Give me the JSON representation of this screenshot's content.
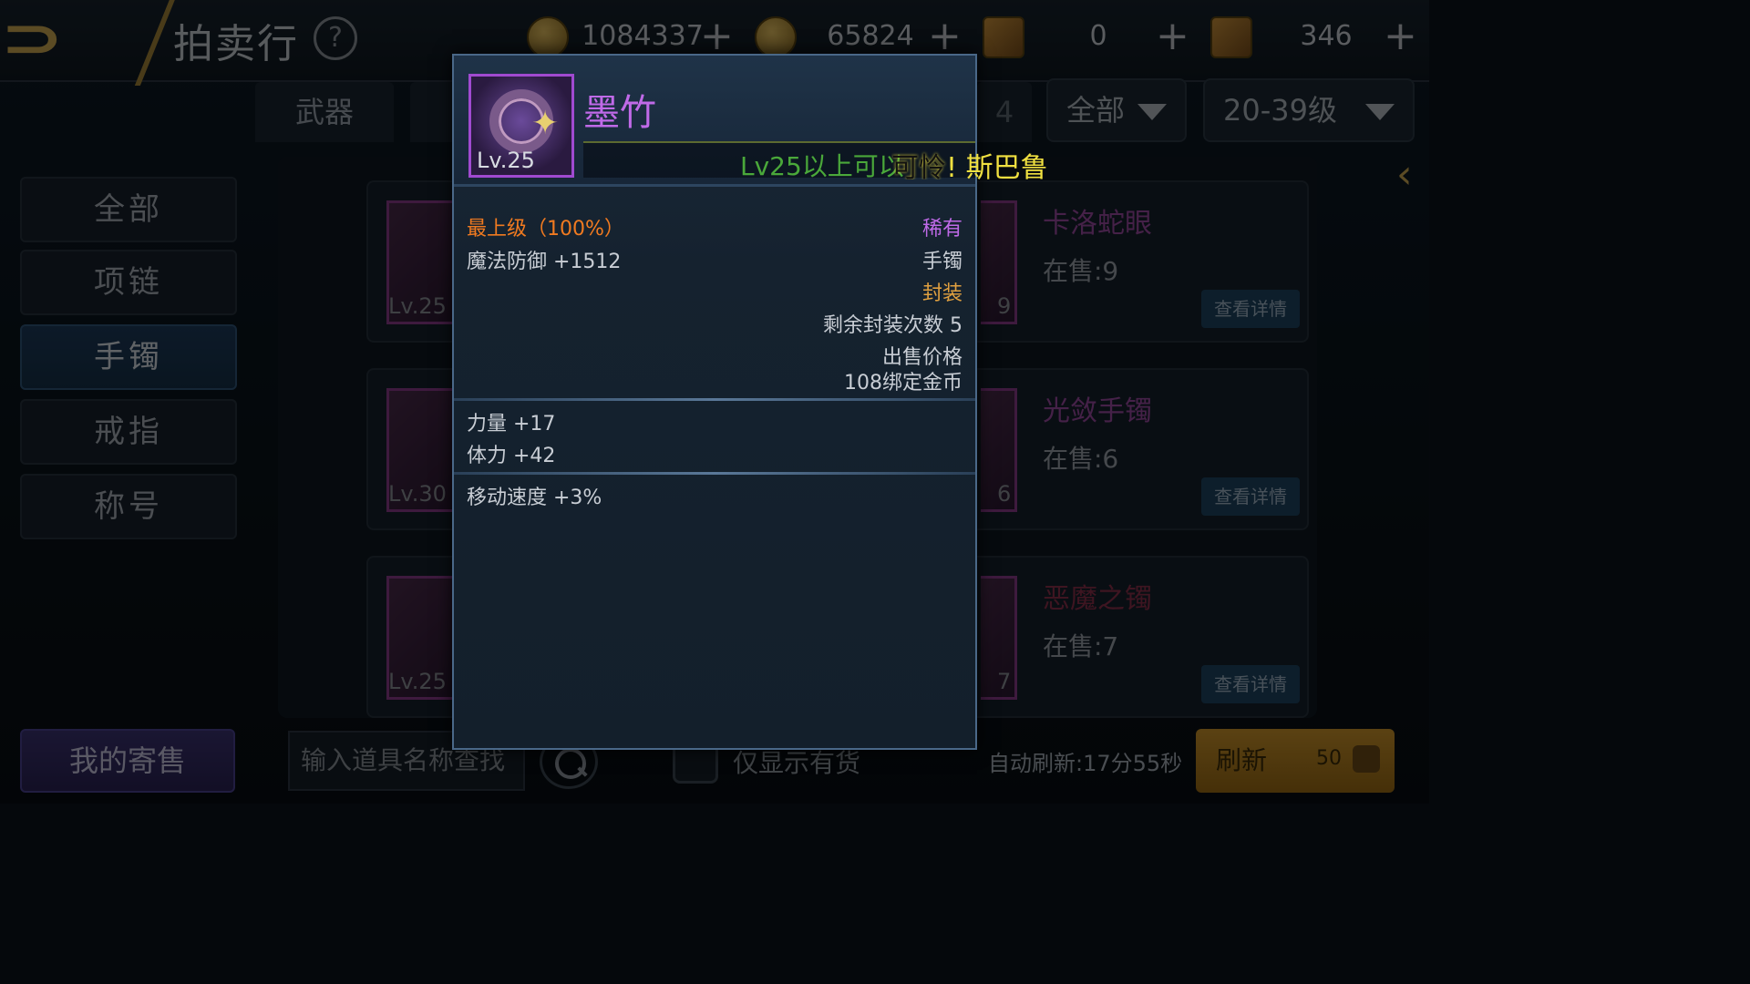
{
  "header": {
    "title": "拍卖行",
    "help_glyph": "?",
    "currencies": [
      {
        "icon": "gold-coin-icon",
        "value": "1084337"
      },
      {
        "icon": "bound-gold-coin-icon",
        "value": "65824"
      },
      {
        "icon": "scroll-icon",
        "value": "0"
      },
      {
        "icon": "locked-scroll-icon",
        "value": "346"
      }
    ],
    "plus": "+"
  },
  "tabs": {
    "weapon": "武器",
    "partial": "4"
  },
  "filters": {
    "category": "全部",
    "level": "20-39级"
  },
  "sidebar": {
    "items": [
      {
        "label": "全部"
      },
      {
        "label": "项链"
      },
      {
        "label": "手镯"
      },
      {
        "label": "戒指"
      },
      {
        "label": "称号"
      }
    ]
  },
  "list": {
    "items": [
      {
        "level": "Lv.25",
        "count": "9",
        "name": "卡洛蛇眼",
        "stock": "在售:9",
        "button": "查看详情"
      },
      {
        "level": "Lv.30",
        "count": "6",
        "name": "光敛手镯",
        "stock": "在售:6",
        "button": "查看详情"
      },
      {
        "level": "Lv.25",
        "count": "7",
        "name": "恶魔之镯",
        "stock": "在售:7",
        "button": "查看详情"
      }
    ]
  },
  "bottom": {
    "my_sell": "我的寄售",
    "search_placeholder": "输入道具名称查找",
    "stock_only": "仅显示有货",
    "auto_refresh": "自动刷新:17分55秒",
    "refresh": "刷新",
    "refresh_cost": "50"
  },
  "popup": {
    "name": "墨竹",
    "icon_level": "Lv.25",
    "requirement": "Lv25以上可以",
    "chat_scroll_dark": "可怜",
    "chat_scroll_bang": "!",
    "chat_scroll_rest": " 斯巴鲁",
    "grade": "最上级（100%）",
    "rarity": "稀有",
    "base_stat": "魔法防御 +1512",
    "slot": "手镯",
    "sealed": "封装",
    "seal_remaining": "剩余封装次数 5",
    "sell_price_label": "出售价格",
    "sell_price": "108绑定金币",
    "stats": [
      "力量 +17",
      "体力 +42"
    ],
    "extra": "移动速度 +3%"
  }
}
